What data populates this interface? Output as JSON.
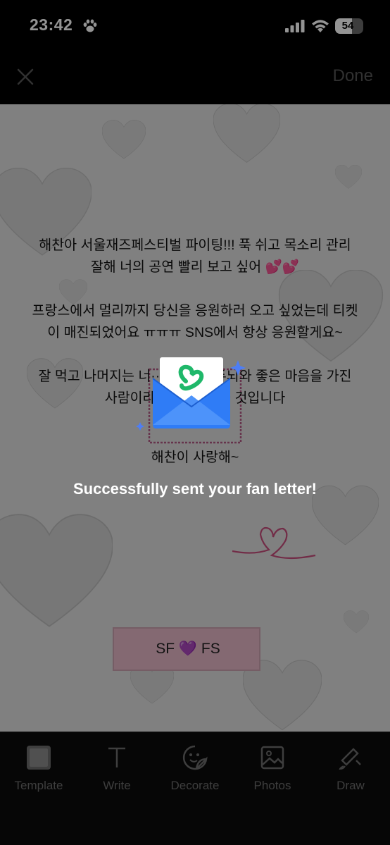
{
  "status_bar": {
    "time": "23:42",
    "battery_level": "54",
    "icons": [
      "paw-icon",
      "cellular-signal-icon",
      "wifi-icon",
      "battery-icon"
    ]
  },
  "nav": {
    "close_icon": "close-icon",
    "done_label": "Done"
  },
  "letter": {
    "paragraphs": [
      "해찬아 서울재즈페스티벌 파이팅!!! 푹 쉬고 목소리 관리 잘해 너의 공연 빨리 보고 싶어 💕💕",
      "프랑스에서 멀리까지 당신을 응원하러 오고 싶었는데 티켓이 매진되었어요 ㅠㅠㅠ SNS에서 항상 응원할게요~",
      "잘 먹고 나머지는 너··· 하세요. 두뇌와 좋은 마음을 가진 사람이라 ··· 곁에 머물 것입니다"
    ],
    "emoji_line": "😽",
    "closing_partial": "해찬이 사랑해~",
    "signature": "SF 💜 FS"
  },
  "overlay": {
    "message": "Successfully sent your fan letter!",
    "icon": "envelope-letter-icon"
  },
  "toolbar": {
    "items": [
      {
        "label": "Template",
        "icon": "template-icon"
      },
      {
        "label": "Write",
        "icon": "text-icon"
      },
      {
        "label": "Decorate",
        "icon": "sticker-icon"
      },
      {
        "label": "Photos",
        "icon": "image-icon"
      },
      {
        "label": "Draw",
        "icon": "brush-icon"
      }
    ]
  },
  "colors": {
    "background": "#000000",
    "canvas": "#dcdcdc",
    "accent_green": "#1fb86a",
    "envelope_blue": "#2f7cf6",
    "signature_pink": "#e3b6c4"
  }
}
